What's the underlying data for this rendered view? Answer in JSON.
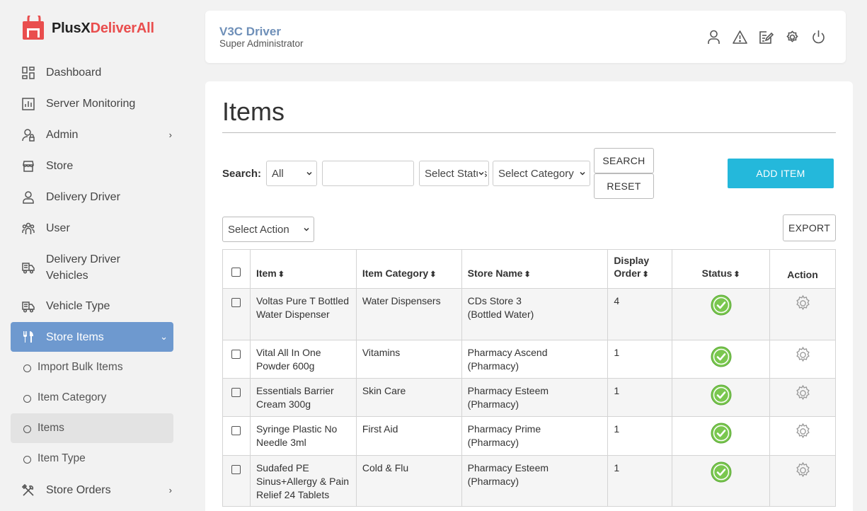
{
  "brand": {
    "part1": "PlusX",
    "part2": "DeliverAll"
  },
  "sidebar": {
    "items": [
      {
        "label": "Dashboard",
        "icon": "dashboard-icon"
      },
      {
        "label": "Server Monitoring",
        "icon": "monitor-chart-icon"
      },
      {
        "label": "Admin",
        "icon": "admin-user-icon"
      },
      {
        "label": "Store",
        "icon": "store-icon"
      },
      {
        "label": "Delivery Driver",
        "icon": "driver-icon"
      },
      {
        "label": "User",
        "icon": "users-icon"
      },
      {
        "label": "Delivery Driver Vehicles",
        "line1": "Delivery Driver",
        "line2": "Vehicles",
        "icon": "vehicle-icon"
      },
      {
        "label": "Vehicle Type",
        "icon": "vehicle-type-icon"
      },
      {
        "label": "Store Items",
        "icon": "fork-knife-icon"
      },
      {
        "label": "Store Orders",
        "icon": "tools-icon"
      }
    ],
    "sub_items": [
      {
        "label": "Import Bulk Items"
      },
      {
        "label": "Item Category"
      },
      {
        "label": "Items"
      },
      {
        "label": "Item Type"
      }
    ]
  },
  "header": {
    "user_name": "V3C Driver",
    "user_role": "Super Administrator"
  },
  "page": {
    "title": "Items"
  },
  "search": {
    "label": "Search:",
    "scope_value": "All",
    "status_value": "Select Status",
    "category_value": "Select Category",
    "search_button": "SEARCH",
    "reset_button": "RESET"
  },
  "toolbar": {
    "add_item": "ADD ITEM",
    "bulk_action": "Select Action",
    "export": "EXPORT"
  },
  "table": {
    "headers": {
      "item": "Item",
      "category": "Item Category",
      "store": "Store Name",
      "order1": "Display",
      "order2": "Order",
      "status": "Status",
      "action": "Action"
    },
    "rows": [
      {
        "item": "Voltas Pure T Bottled Water Dispenser",
        "category": "Water Dispensers",
        "store1": "CDs Store 3",
        "store2": "(Bottled Water)",
        "order": "4",
        "status": "active"
      },
      {
        "item": "Vital All In One Powder 600g",
        "category": "Vitamins",
        "store1": "Pharmacy Ascend",
        "store2": "(Pharmacy)",
        "order": "1",
        "status": "active"
      },
      {
        "item": "Essentials Barrier Cream 300g",
        "category": "Skin Care",
        "store1": "Pharmacy Esteem",
        "store2": "(Pharmacy)",
        "order": "1",
        "status": "active"
      },
      {
        "item": "Syringe Plastic No Needle 3ml",
        "category": "First Aid",
        "store1": "Pharmacy Prime",
        "store2": "(Pharmacy)",
        "order": "1",
        "status": "active"
      },
      {
        "item": "Sudafed PE Sinus+Allergy & Pain Relief 24 Tablets",
        "category": "Cold & Flu",
        "store1": "Pharmacy Esteem",
        "store2": "(Pharmacy)",
        "order": "1",
        "status": "active"
      }
    ]
  },
  "colors": {
    "accent": "#24b8db",
    "active_nav": "#6e99cf",
    "brand_red": "#e94e4e",
    "status_green": "#7ac74f"
  }
}
